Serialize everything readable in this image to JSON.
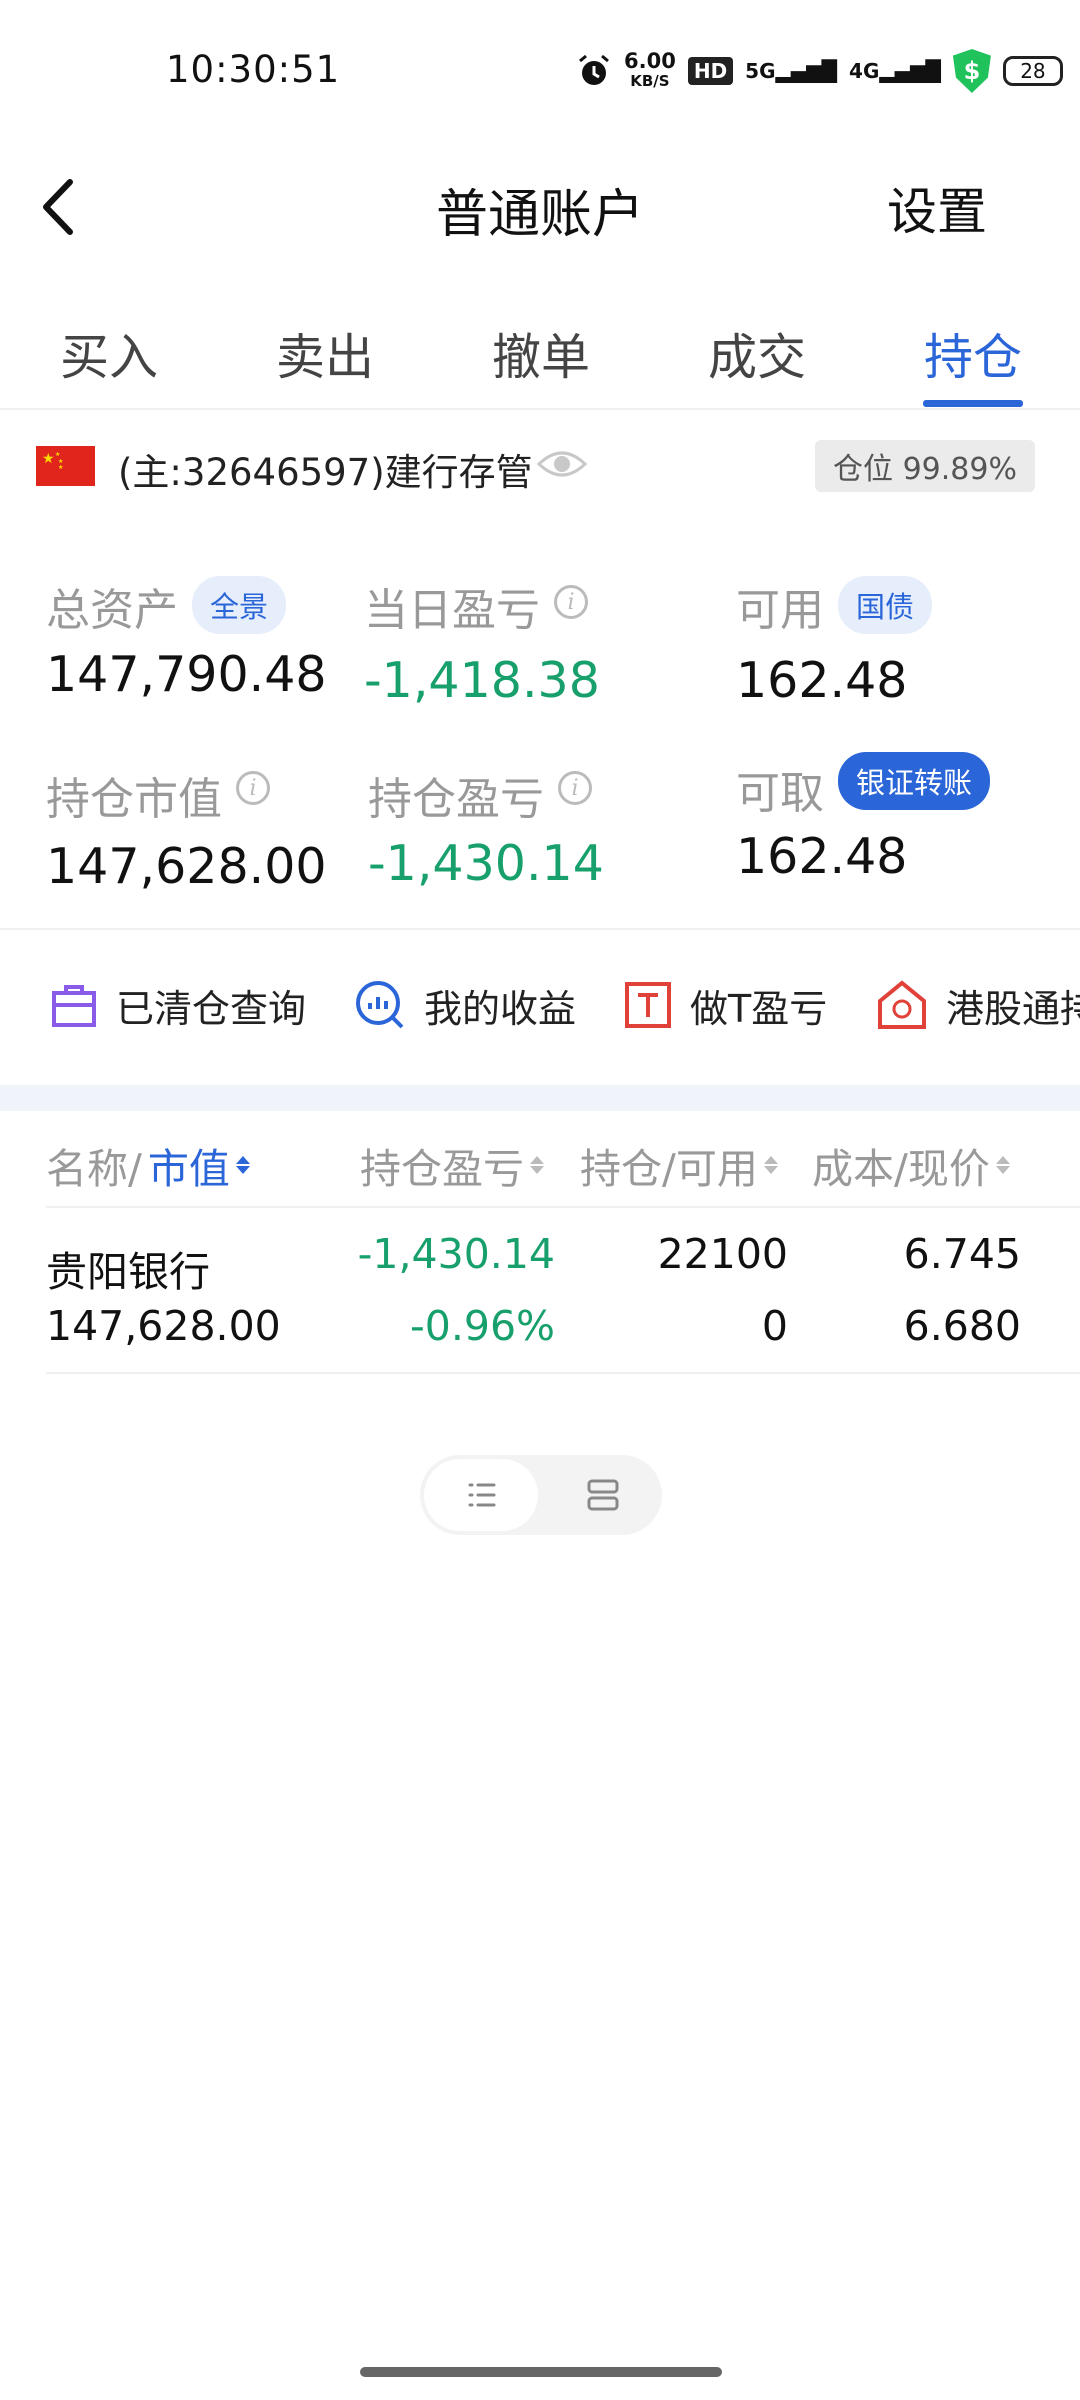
{
  "status_bar": {
    "time": "10:30:51",
    "speed_value": "6.00",
    "speed_unit": "KB/S",
    "hd": "HD",
    "signal_5g": "5G",
    "signal_4g": "4G",
    "battery": "28"
  },
  "header": {
    "title": "普通账户",
    "settings_label": "设置"
  },
  "tabs": [
    {
      "label": "买入"
    },
    {
      "label": "卖出"
    },
    {
      "label": "撤单"
    },
    {
      "label": "成交"
    },
    {
      "label": "持仓",
      "active": true
    }
  ],
  "account": {
    "name": "(主:32646597)建行存管",
    "position_ratio": "仓位 99.89%"
  },
  "summary": {
    "total_assets": {
      "label": "总资产",
      "badge": "全景",
      "value": "147,790.48"
    },
    "daily_pnl": {
      "label": "当日盈亏",
      "value": "-1,418.38"
    },
    "available": {
      "label": "可用",
      "badge": "国债",
      "value": "162.48"
    },
    "holding_value": {
      "label": "持仓市值",
      "value": "147,628.00"
    },
    "holding_pnl": {
      "label": "持仓盈亏",
      "value": "-1,430.14"
    },
    "withdrawable": {
      "label": "可取",
      "badge": "银证转账",
      "value": "162.48"
    }
  },
  "quick_actions": [
    {
      "label": "已清仓查询",
      "icon": "cleared-briefcase-icon"
    },
    {
      "label": "我的收益",
      "icon": "earnings-chart-icon"
    },
    {
      "label": "做T盈亏",
      "icon": "t-trade-icon"
    },
    {
      "label": "港股通持",
      "icon": "hk-connect-icon"
    }
  ],
  "table": {
    "headers": {
      "name_prefix": "名称/",
      "name_highlight": "市值",
      "pnl": "持仓盈亏",
      "qty": "持仓/可用",
      "price": "成本/现价"
    },
    "rows": [
      {
        "name": "贵阳银行",
        "market_value": "147,628.00",
        "pnl": "-1,430.14",
        "pnl_pct": "-0.96%",
        "holding": "22100",
        "available": "0",
        "cost": "6.745",
        "price": "6.680"
      }
    ]
  },
  "colors": {
    "accent": "#2b66d9",
    "loss": "#17a06b",
    "muted": "#999999"
  }
}
